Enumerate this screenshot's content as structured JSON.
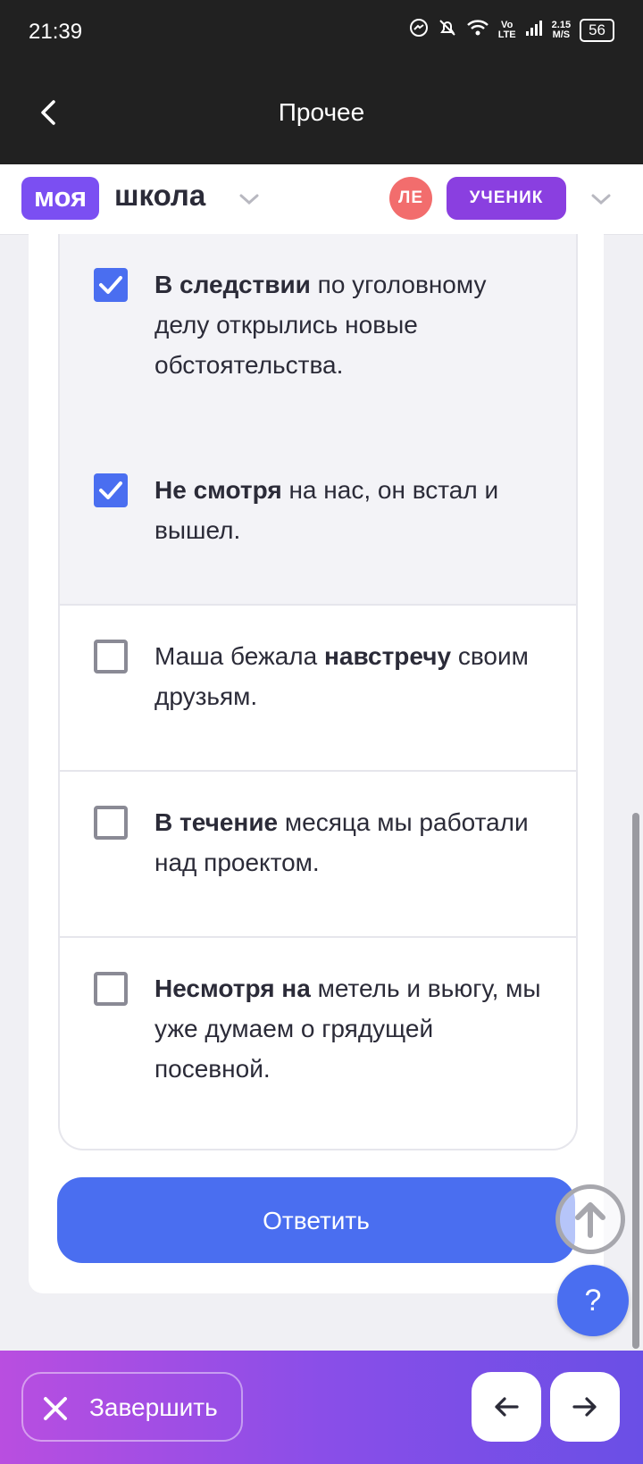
{
  "status": {
    "time": "21:39",
    "net_top": "Vo",
    "net_bottom": "LTE",
    "speed_top": "2.15",
    "speed_bottom": "M/S",
    "battery": "56"
  },
  "appbar": {
    "title": "Прочее"
  },
  "brand": {
    "moya": "моя",
    "shkola": "школа"
  },
  "user": {
    "initials": "ЛЕ",
    "role": "УЧЕНИК"
  },
  "options": [
    {
      "checked": true,
      "bold": "В следствии",
      "rest": " по уголовному делу открылись новые обстоятельства."
    },
    {
      "checked": true,
      "bold": "Не смотря",
      "rest": " на нас, он встал и вышел."
    },
    {
      "checked": false,
      "before": "Маша бежала ",
      "bold": "навстречу",
      "rest": " своим друзьям."
    },
    {
      "checked": false,
      "bold": "В течение",
      "rest": " месяца мы работали над проектом."
    },
    {
      "checked": false,
      "bold": "Несмотря на",
      "rest": " метель и вьюгу, мы уже думаем о грядущей посевной."
    }
  ],
  "answer_label": "Ответить",
  "help_label": "?",
  "bottom": {
    "finish_label": "Завершить"
  },
  "colors": {
    "accent": "#4a6ef0",
    "brand": "#7b4ff2",
    "role": "#8a3fe0",
    "avatar": "#f26d6d"
  },
  "icons": [
    "back-arrow-icon",
    "chevron-down-icon",
    "check-icon",
    "arrow-up-icon",
    "close-icon",
    "arrow-left-icon",
    "arrow-right-icon"
  ]
}
